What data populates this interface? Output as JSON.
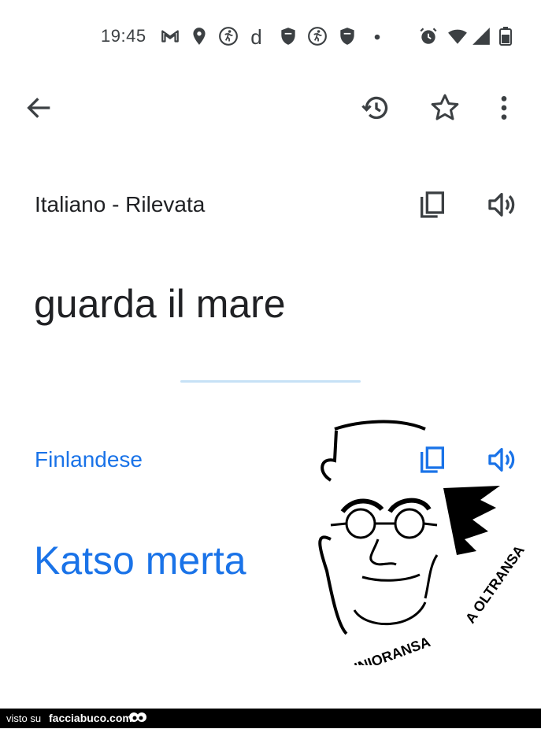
{
  "status_bar": {
    "time": "19:45",
    "icons": [
      "gmail-icon",
      "location-icon",
      "fitness-icon",
      "d-app-icon",
      "shield-icon",
      "fitness-icon",
      "shield-icon",
      "dot-icon",
      "alarm-icon",
      "wifi-icon",
      "signal-icon",
      "battery-icon"
    ]
  },
  "app_bar": {
    "back_icon": "arrow-back-icon",
    "history_icon": "history-icon",
    "star_icon": "star-outline-icon",
    "more_icon": "more-vert-icon"
  },
  "source": {
    "language_label": "Italiano - Rilevata",
    "text": "guarda il mare",
    "copy_icon": "copy-icon",
    "speak_icon": "volume-icon"
  },
  "target": {
    "language_label": "Finlandese",
    "text": "Katso merta",
    "copy_icon": "copy-icon",
    "speak_icon": "volume-icon"
  },
  "watermark": {
    "caption": "INIORANSA A OLTRANSA"
  },
  "footer": {
    "visto_su": "visto su",
    "site": "facciabuco.com"
  },
  "colors": {
    "accent": "#1a73e8",
    "text": "#202124",
    "icon": "#3c4043",
    "divider": "#c6e1f6",
    "footer_bg": "#000000"
  }
}
